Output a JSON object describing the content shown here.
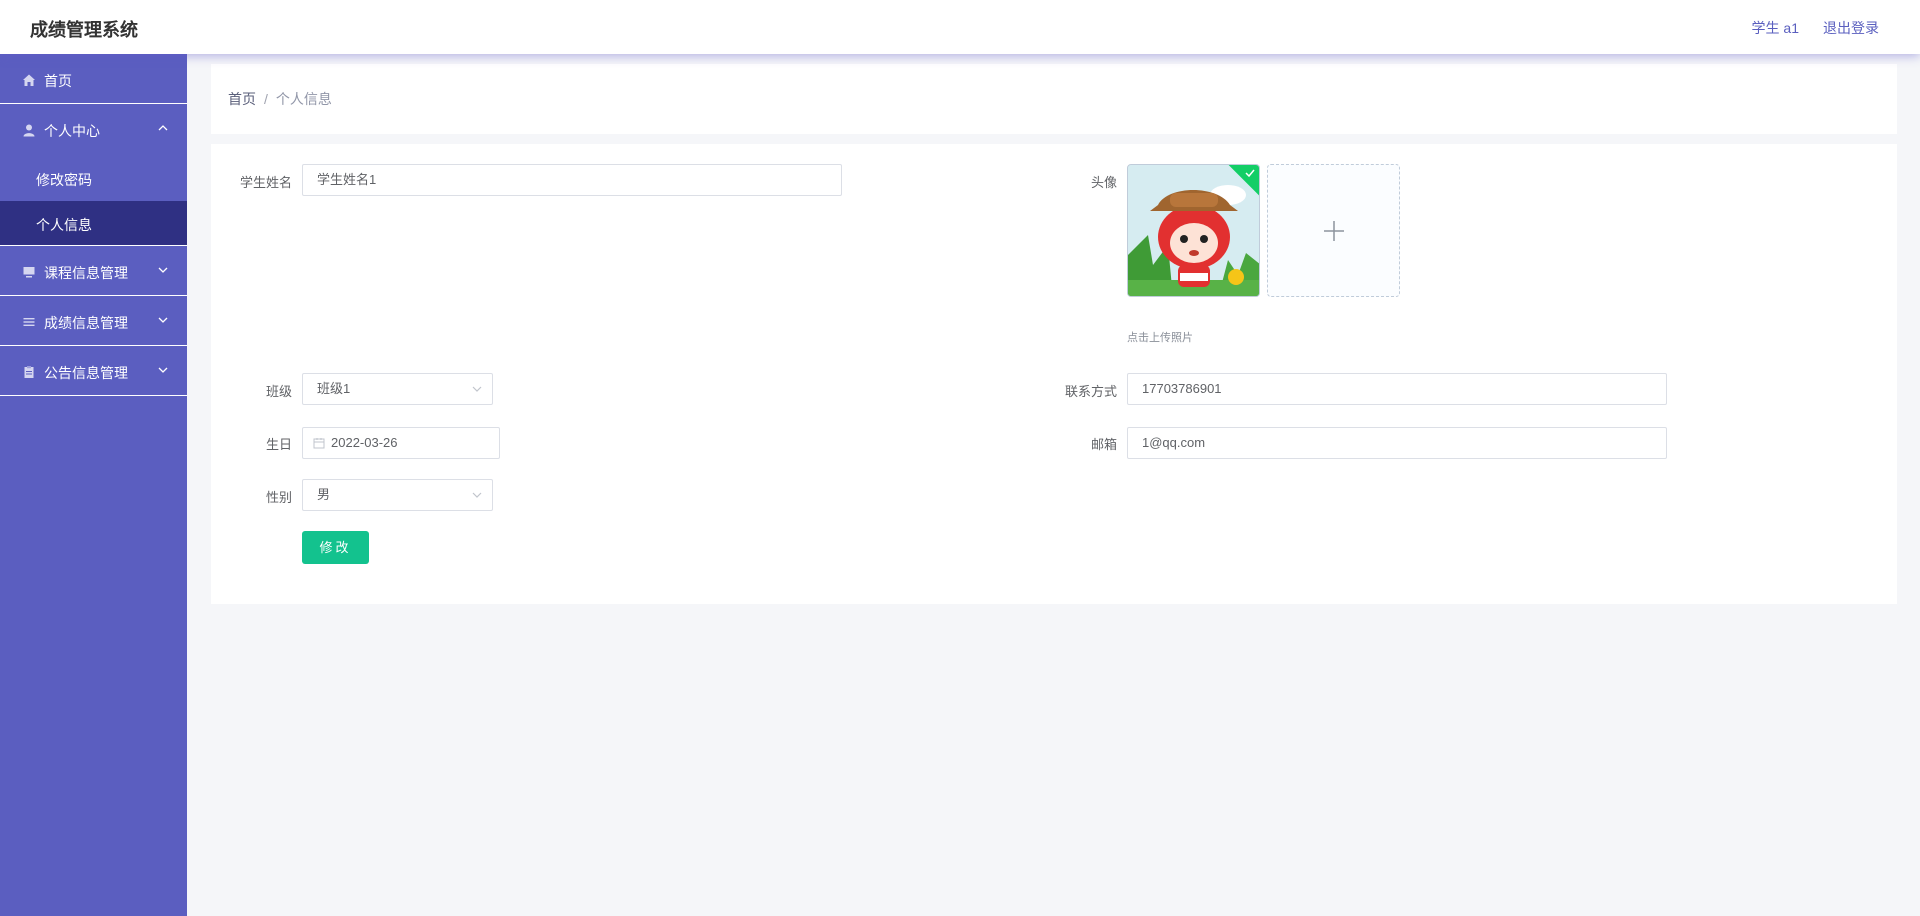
{
  "header": {
    "app_title": "成绩管理系统",
    "user_name": "学生 a1",
    "logout_label": "退出登录"
  },
  "sidebar": {
    "items": [
      {
        "label": "首页",
        "icon": "home-icon"
      },
      {
        "label": "个人中心",
        "icon": "user-icon",
        "expanded": true,
        "children": [
          {
            "label": "修改密码"
          },
          {
            "label": "个人信息",
            "active": true
          }
        ]
      },
      {
        "label": "课程信息管理",
        "icon": "monitor-icon"
      },
      {
        "label": "成绩信息管理",
        "icon": "list-icon"
      },
      {
        "label": "公告信息管理",
        "icon": "clipboard-icon"
      }
    ]
  },
  "breadcrumb": {
    "home": "首页",
    "separator": "/",
    "current": "个人信息"
  },
  "form": {
    "name_label": "学生姓名",
    "name_value": "学生姓名1",
    "avatar_label": "头像",
    "upload_tip": "点击上传照片",
    "class_label": "班级",
    "class_value": "班级1",
    "phone_label": "联系方式",
    "phone_value": "17703786901",
    "birthday_label": "生日",
    "birthday_value": "2022-03-26",
    "email_label": "邮箱",
    "email_value": "1@qq.com",
    "gender_label": "性别",
    "gender_value": "男",
    "submit_label": "修改"
  },
  "colors": {
    "sidebar_bg": "#5b5ec0",
    "sidebar_active": "#2f3083",
    "accent": "#5a5fbf",
    "button": "#13c28e",
    "upload_success": "#13ce66"
  }
}
